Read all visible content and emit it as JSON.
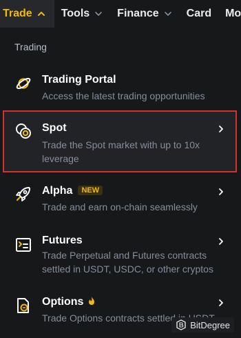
{
  "nav": {
    "items": [
      {
        "label": "Trade",
        "has_chevron": true,
        "chevron": "up",
        "active": true
      },
      {
        "label": "Tools",
        "has_chevron": true,
        "chevron": "down"
      },
      {
        "label": "Finance",
        "has_chevron": true,
        "chevron": "down"
      },
      {
        "label": "Card",
        "has_chevron": false
      },
      {
        "label": "More",
        "has_chevron": false
      }
    ]
  },
  "section_label": "Trading",
  "menu": [
    {
      "title": "Trading Portal",
      "desc": "Access the latest trading opportunities",
      "icon": "planet-icon",
      "has_arrow": false
    },
    {
      "title": "Spot",
      "desc": "Trade the Spot market with up to 10x leverage",
      "icon": "spot-coins-icon",
      "has_arrow": true,
      "highlighted": true
    },
    {
      "title": "Alpha",
      "badge": "NEW",
      "desc": "Trade and earn on-chain seamlessly",
      "icon": "rocket-icon",
      "has_arrow": true
    },
    {
      "title": "Futures",
      "desc": "Trade Perpetual and Futures contracts settled in USDT, USDC, or other cryptos",
      "icon": "futures-icon",
      "has_arrow": true
    },
    {
      "title": "Options",
      "desc": "Trade Options contracts settled in USDT",
      "icon": "options-icon",
      "has_arrow": true,
      "flame": true
    }
  ],
  "watermark": "BitDegree",
  "colors": {
    "accent": "#f0b90b",
    "background": "#17181a",
    "highlight_border": "#d4322c",
    "text_primary": "#ffffff",
    "text_secondary": "#848e9c"
  }
}
